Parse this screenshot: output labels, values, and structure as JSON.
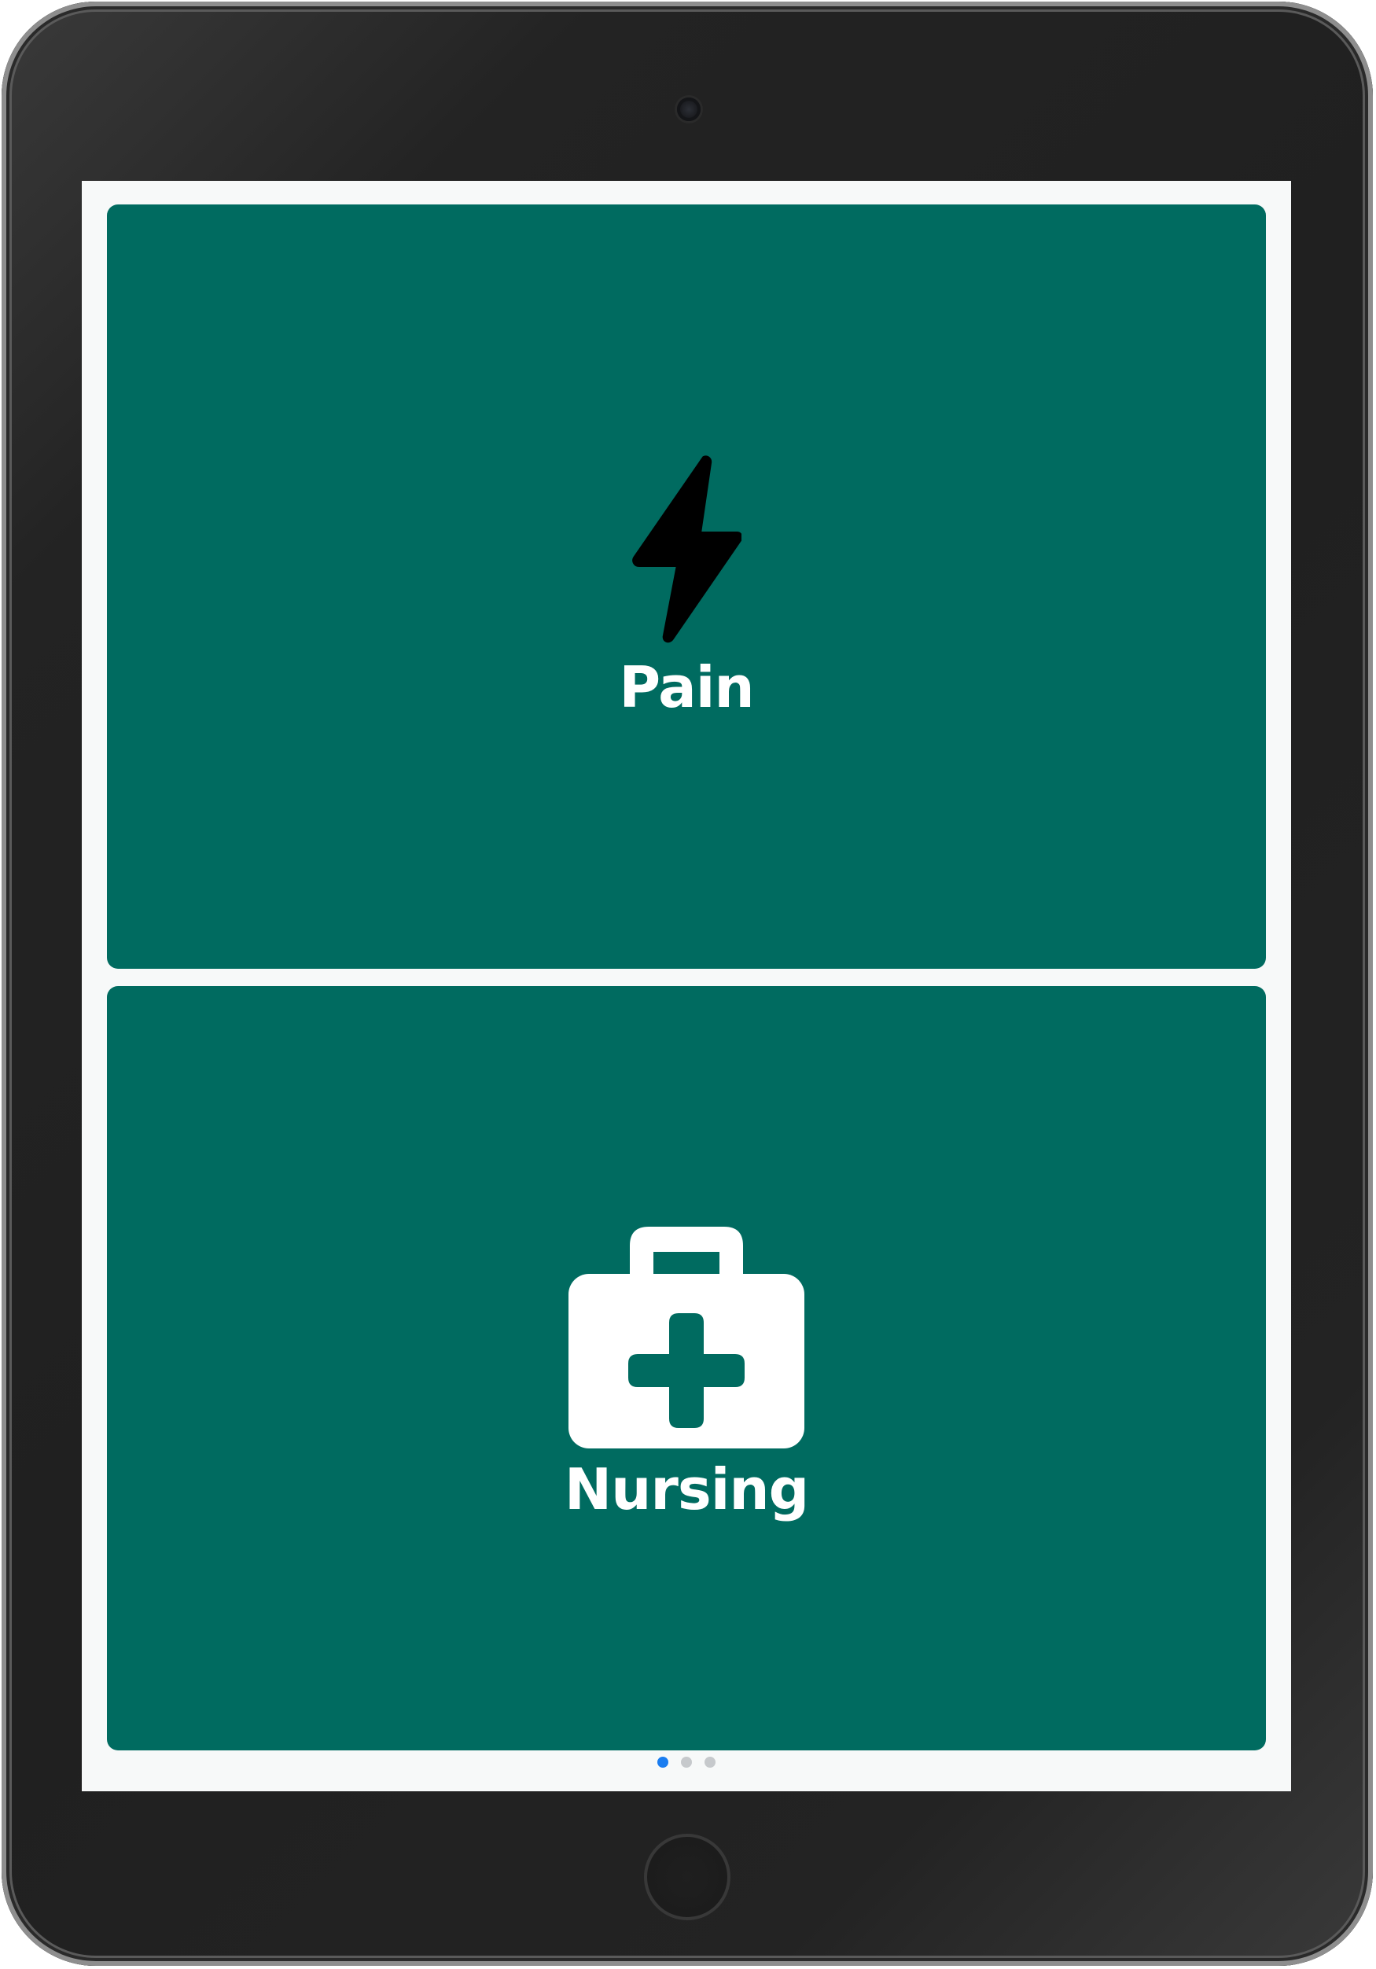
{
  "tiles": [
    {
      "label": "Pain",
      "icon": "lightning-bolt-icon",
      "color": "#006b60"
    },
    {
      "label": "Nursing",
      "icon": "medical-kit-icon",
      "color": "#006b60"
    }
  ],
  "pager": {
    "total": 3,
    "active": 1
  },
  "colors": {
    "tile": "#006b60",
    "screen_background": "#f7f9f9",
    "pager_active": "#1a7df0",
    "pager_inactive": "#c6c9cc",
    "device_bezel": "#222222"
  }
}
